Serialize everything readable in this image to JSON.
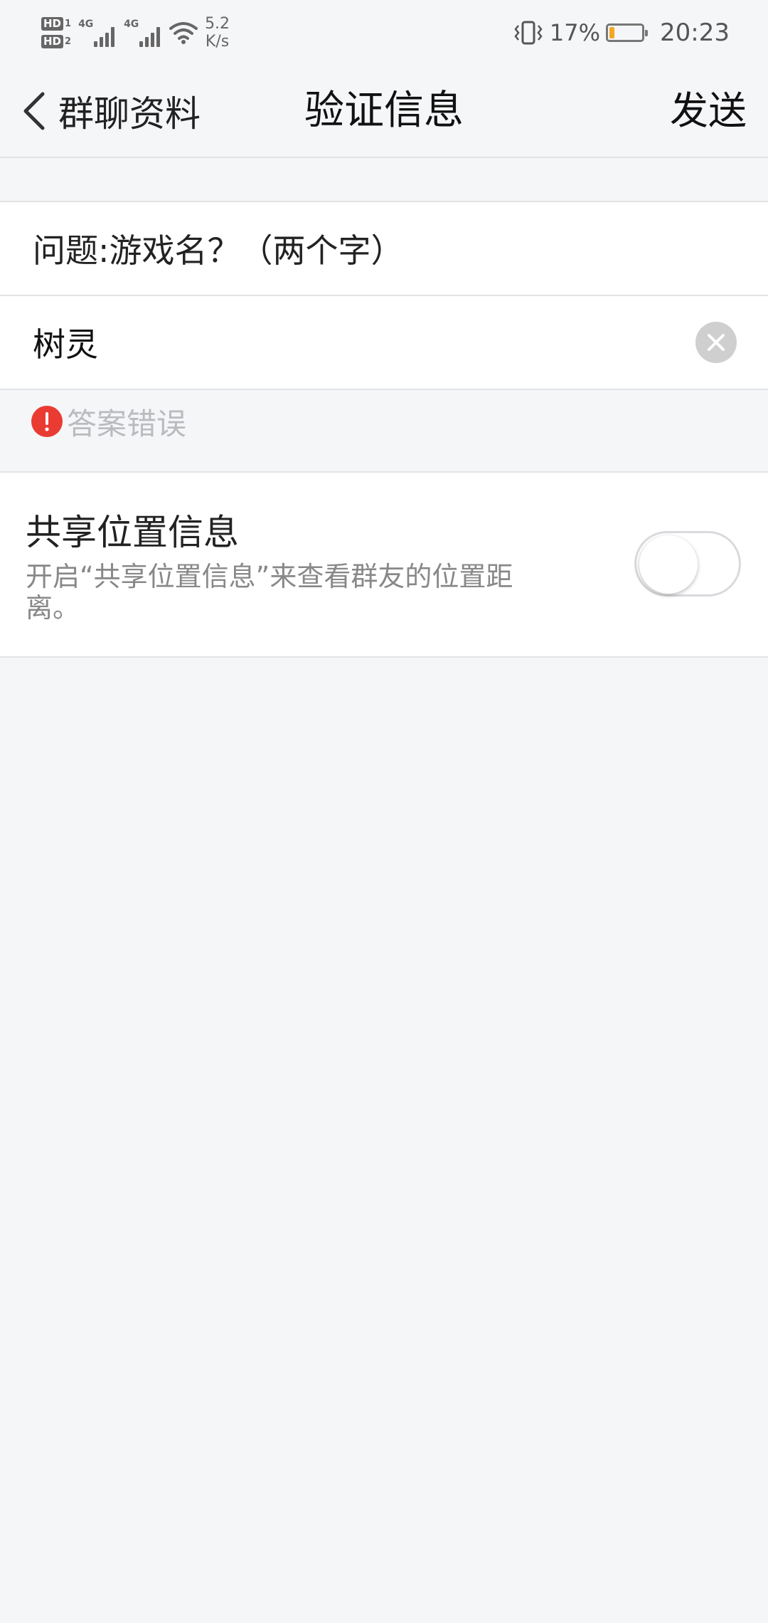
{
  "status_bar": {
    "sim1_label": "HD",
    "sim1_index": "1",
    "sim2_label": "HD",
    "sim2_index": "2",
    "network1": "4G",
    "network2": "4G",
    "speed_value": "5.2",
    "speed_unit": "K/s",
    "battery_percent": "17%",
    "battery_level": 0.17,
    "battery_color": "#f5a623",
    "time": "20:23",
    "icons": [
      "signal-icon",
      "wifi-icon",
      "vibrate-icon",
      "battery-icon"
    ]
  },
  "nav": {
    "back_label": "群聊资料",
    "title": "验证信息",
    "send_label": "发送",
    "back_icon": "chevron-left-icon"
  },
  "form": {
    "question": "问题:游戏名？（两个字）",
    "answer_value": "树灵",
    "clear_icon": "clear-icon"
  },
  "error": {
    "message": "答案错误",
    "icon": "exclamation-icon",
    "color": "#ea3b33"
  },
  "share_location": {
    "title": "共享位置信息",
    "description": "开启“共享位置信息”来查看群友的位置距离。",
    "enabled": false
  }
}
